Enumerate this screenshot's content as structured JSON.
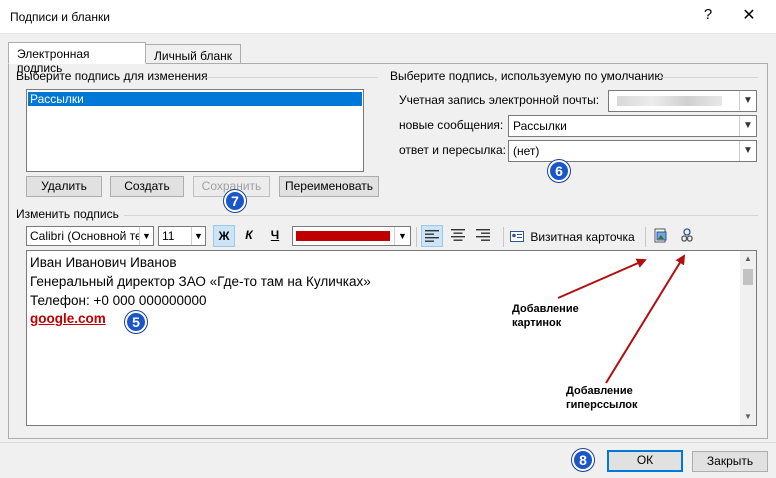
{
  "window": {
    "title": "Подписи и бланки",
    "help": "?",
    "close": "✕"
  },
  "tabs": [
    {
      "label": "Электронная подпись",
      "active": true
    },
    {
      "label": "Личный бланк",
      "active": false
    }
  ],
  "select_signature": {
    "heading": "Выберите подпись для изменения",
    "items": [
      "Рассылки"
    ],
    "buttons": {
      "delete": "Удалить",
      "create": "Создать",
      "save": "Сохранить",
      "rename": "Переименовать"
    }
  },
  "defaults": {
    "heading": "Выберите подпись, используемую по умолчанию",
    "account_label": "Учетная запись электронной почты:",
    "account_value": "",
    "new_messages_label": "новые сообщения:",
    "new_messages_value": "Рассылки",
    "reply_label": "ответ и пересылка:",
    "reply_value": "(нет)"
  },
  "editor": {
    "heading": "Изменить подпись",
    "font": "Calibri (Основной текст)",
    "size": "11",
    "bold": "Ж",
    "italic": "К",
    "underline": "Ч",
    "font_color": "#c00000",
    "business_card": "Визитная карточка",
    "lines": [
      "Иван Иванович Иванов",
      "Генеральный директор ЗАО «Где-то там на Куличках»",
      "Телефон: +0 000 000000000"
    ],
    "link": "google.com"
  },
  "annotations": {
    "badge5": "5",
    "badge6": "6",
    "badge7": "7",
    "badge8": "8",
    "pictures": "Добавление картинок",
    "hyperlinks": "Добавление гиперссылок",
    "arrow_color": "#b01010",
    "badge_color": "#1a56c8"
  },
  "footer": {
    "ok": "ОК",
    "close": "Закрыть"
  }
}
